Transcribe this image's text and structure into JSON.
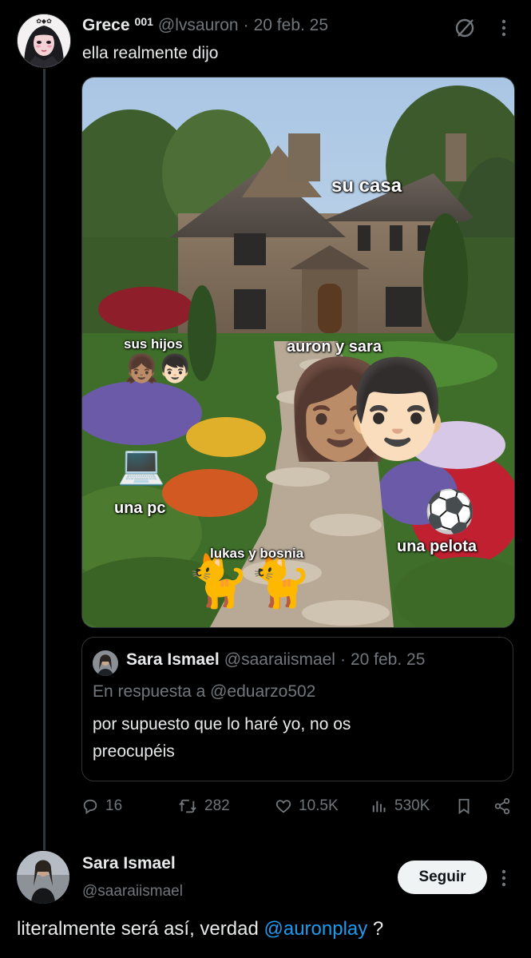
{
  "tweet": {
    "display_name": "Grece",
    "name_badge": "001",
    "handle": "@lvsauron",
    "separator": "·",
    "date": "20 feb. 25",
    "text": "ella realmente dijo",
    "more_icon": "more-vertical-icon",
    "grok_icon": "slash-circle-icon"
  },
  "meme": {
    "labels": {
      "house": "su casa",
      "kids": "sus hijos",
      "couple": "auron y sara",
      "pc": "una pc",
      "ball": "una pelota",
      "cats": "lukas y bosnia"
    },
    "emojis": {
      "girl": "👧🏽",
      "boy": "👦🏻",
      "woman": "👩🏽",
      "man": "👨🏻",
      "laptop": "💻",
      "ball": "⚽",
      "cat": "🐈"
    }
  },
  "quote": {
    "display_name": "Sara Ismael",
    "handle": "@saaraiismael",
    "separator": "·",
    "date": "20 feb. 25",
    "reply_prefix": "En respuesta a",
    "reply_to": "@eduarzo502",
    "text_line1": "por supuesto que lo haré yo, no os",
    "text_line2": "preocupéis"
  },
  "actions": {
    "replies": "16",
    "retweets": "282",
    "likes": "10.5K",
    "views": "530K"
  },
  "reply": {
    "display_name": "Sara Ismael",
    "handle": "@saaraiismael",
    "follow_label": "Seguir",
    "text_before": "literalmente será así, verdad ",
    "mention": "@auronplay",
    "text_after": " ?"
  },
  "colors": {
    "background": "#000000",
    "text": "#e7e9ea",
    "muted": "#71767b",
    "accent": "#1d9bf0",
    "border": "#2f3336"
  }
}
